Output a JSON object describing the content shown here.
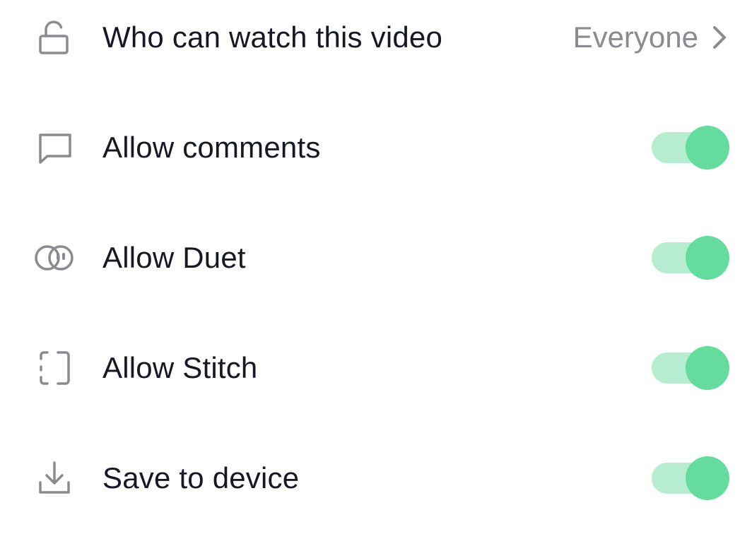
{
  "colors": {
    "text": "#161823",
    "secondary_text": "#8a8b91",
    "icon": "#8a8b91",
    "toggle_on_track": "#b6ecd0",
    "toggle_on_knob": "#63dc9e"
  },
  "settings": {
    "who_can_watch": {
      "icon": "lock-icon",
      "label": "Who can watch this video",
      "value": "Everyone",
      "trailing_icon": "chevron-right-icon"
    },
    "allow_comments": {
      "icon": "comment-icon",
      "label": "Allow comments",
      "enabled": true
    },
    "allow_duet": {
      "icon": "duet-icon",
      "label": "Allow Duet",
      "enabled": true
    },
    "allow_stitch": {
      "icon": "stitch-icon",
      "label": "Allow Stitch",
      "enabled": true
    },
    "save_to_device": {
      "icon": "download-icon",
      "label": "Save to device",
      "enabled": true
    }
  }
}
